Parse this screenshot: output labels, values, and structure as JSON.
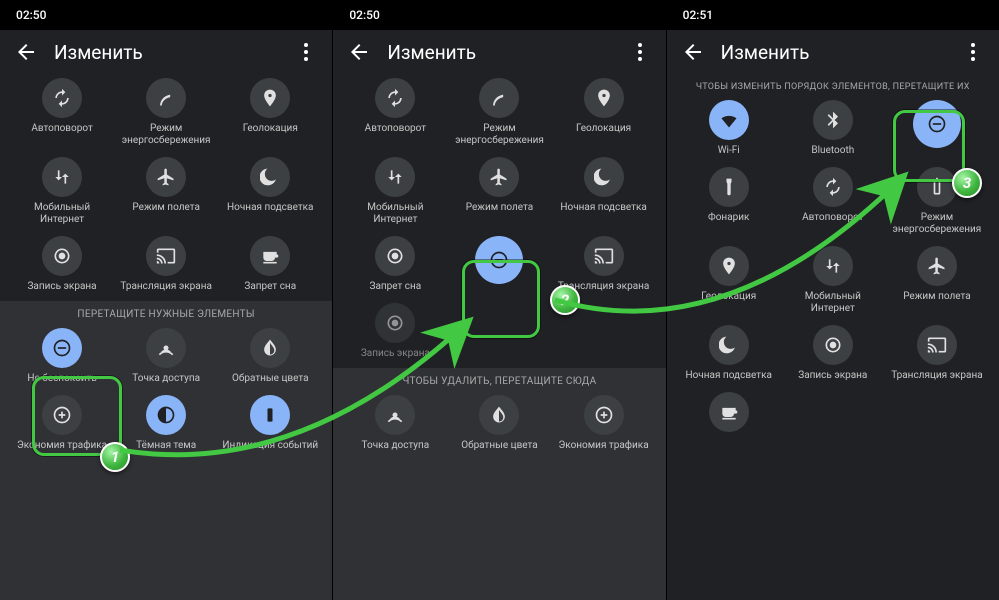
{
  "s1": {
    "time": "02:50",
    "title": "Изменить",
    "tiles": {
      "r1": [
        "Автоповорот",
        "Режим\nэнергосбережения",
        "Геолокация"
      ],
      "r2": [
        "Мобильный\nИнтернет",
        "Режим полета",
        "Ночная подсветка"
      ],
      "r3": [
        "Запись экрана",
        "Трансляция экрана",
        "Запрет сна"
      ]
    },
    "drag_label": "ПЕРЕТАЩИТЕ НУЖНЫЕ ЭЛЕМЕНТЫ",
    "lower": {
      "r1": [
        "Не беспокоить",
        "Точка доступа",
        "Обратные цвета"
      ],
      "r2": [
        "Экономия трафика",
        "Тёмная тема",
        "Индикация событий"
      ]
    }
  },
  "s2": {
    "time": "02:50",
    "title": "Изменить",
    "tiles": {
      "r1": [
        "Автоповорот",
        "Режим\nэнергосбережения",
        "Геолокация"
      ],
      "r2": [
        "Мобильный\nИнтернет",
        "Режим полета",
        "Ночная подсветка"
      ],
      "r3a": "Запрет сна",
      "r3c": "Трансляция экрана"
    },
    "remove_label": "ЧТОБЫ УДАЛИТЬ, ПЕРЕТАЩИТЕ СЮДА",
    "lower": [
      "Точка доступа",
      "Обратные цвета",
      "Экономия трафика"
    ]
  },
  "s3": {
    "time": "02:51",
    "title": "Изменить",
    "reorder_label": "ЧТОБЫ ИЗМЕНИТЬ ПОРЯДОК ЭЛЕМЕНТОВ, ПЕРЕТАЩИТЕ ИХ",
    "tiles": {
      "r1": [
        "Wi-Fi",
        "Bluetooth",
        ""
      ],
      "r2": [
        "Фонарик",
        "Автоповорот",
        "Режим\nэнергосбережения"
      ],
      "r3": [
        "Геолокация",
        "Мобильный\nИнтернет",
        "Режим полета"
      ],
      "r4": [
        "Ночная подсветка",
        "Запись экрана",
        "Трансляция экрана"
      ],
      "r5a": ""
    }
  },
  "steps": {
    "one": "1",
    "two": "2",
    "three": "3"
  }
}
